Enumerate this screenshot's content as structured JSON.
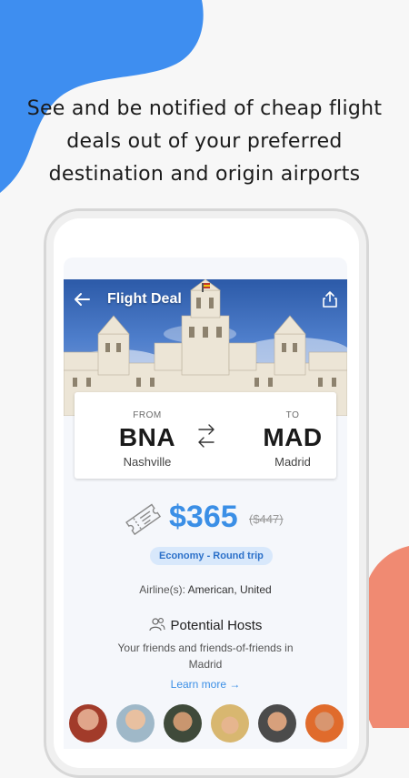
{
  "headline": {
    "line1": "See and be notified of cheap flight",
    "line2": "deals out of your preferred",
    "line3": "destination and origin airports"
  },
  "colors": {
    "accent_blue": "#3b8fe6",
    "blob_blue": "#3e8ef0",
    "blob_coral": "#f08a72",
    "pill_bg": "#d8e8fb"
  },
  "app": {
    "title": "Flight Deal",
    "icons": {
      "back": "arrow-left-icon",
      "share": "share-icon",
      "swap": "swap-arrows-icon",
      "ticket": "ticket-icon",
      "hosts": "users-icon"
    },
    "route": {
      "from_caption": "FROM",
      "from_code": "BNA",
      "from_city": "Nashville",
      "to_caption": "TO",
      "to_code": "MAD",
      "to_city": "Madrid"
    },
    "price": "$365",
    "old_price": "($447)",
    "fare_class": "Economy - Round trip",
    "airline_label": "Airline(s):",
    "airline_value": "American, United",
    "hosts_title": "Potential Hosts",
    "hosts_subtitle": "Your friends and friends-of-friends in Madrid",
    "learn_more": "Learn more →"
  }
}
